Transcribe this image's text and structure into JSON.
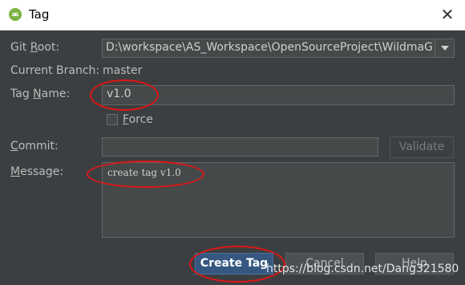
{
  "window": {
    "title": "Tag",
    "close_glyph": "✕"
  },
  "form": {
    "git_root": {
      "label_pre": "Git ",
      "label_mn": "R",
      "label_post": "oot:",
      "value": "D:\\workspace\\AS_Workspace\\OpenSourceProject\\WildmaGit"
    },
    "current_branch": {
      "label": "Current Branch:",
      "value": "master"
    },
    "tag_name": {
      "label_pre": "Tag ",
      "label_mn": "N",
      "label_post": "ame:",
      "value": "v1.0"
    },
    "force": {
      "label_mn": "F",
      "label_post": "orce",
      "checked": false
    },
    "commit": {
      "label_mn": "C",
      "label_post": "ommit:",
      "value": ""
    },
    "validate_label": "Validate",
    "message": {
      "label_mn": "M",
      "label_post": "essage:",
      "value": "create tag v1.0"
    }
  },
  "buttons": {
    "create": "Create Tag",
    "cancel": "Cancel",
    "help": "Help"
  },
  "watermark": "https://blog.csdn.net/Dang321580",
  "colors": {
    "background": "#3c3f41",
    "accent": "#365880",
    "annotation": "#e01616"
  }
}
